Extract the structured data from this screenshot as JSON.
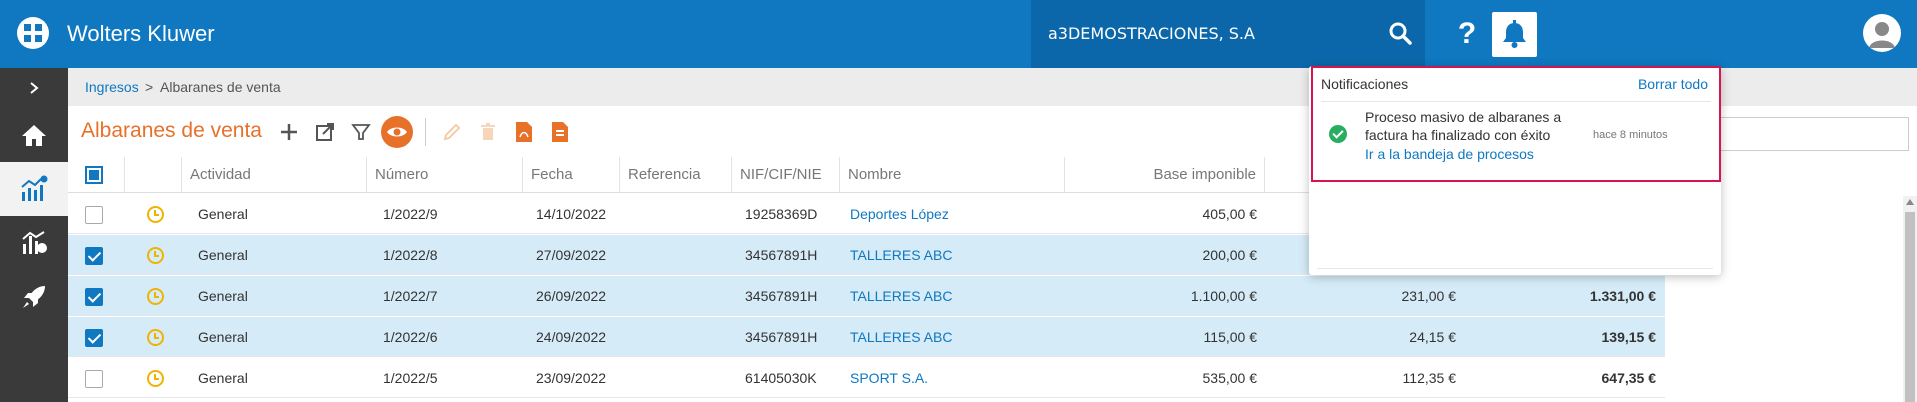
{
  "header": {
    "brand": "Wolters Kluwer",
    "company": "a3DEMOSTRACIONES, S.A",
    "help_label": "?",
    "accent": "#0f78c1"
  },
  "breadcrumb": {
    "parent": "Ingresos",
    "separator": ">",
    "current": "Albaranes de venta"
  },
  "page": {
    "title": "Albaranes de venta",
    "title_color": "#e8712a"
  },
  "table": {
    "columns": [
      "Actividad",
      "Número",
      "Fecha",
      "Referencia",
      "NIF/CIF/NIE",
      "Nombre",
      "Base imponible"
    ],
    "rows": [
      {
        "selected": false,
        "actividad": "General",
        "numero": "1/2022/9",
        "fecha": "14/10/2022",
        "referencia": "",
        "nif": "19258369D",
        "nombre": "Deportes López",
        "base": "405,00 €",
        "cuota": "",
        "total": ""
      },
      {
        "selected": true,
        "actividad": "General",
        "numero": "1/2022/8",
        "fecha": "27/09/2022",
        "referencia": "",
        "nif": "34567891H",
        "nombre": "TALLERES ABC",
        "base": "200,00 €",
        "cuota": "",
        "total": ""
      },
      {
        "selected": true,
        "actividad": "General",
        "numero": "1/2022/7",
        "fecha": "26/09/2022",
        "referencia": "",
        "nif": "34567891H",
        "nombre": "TALLERES ABC",
        "base": "1.100,00 €",
        "cuota": "231,00 €",
        "total": "1.331,00 €"
      },
      {
        "selected": true,
        "actividad": "General",
        "numero": "1/2022/6",
        "fecha": "24/09/2022",
        "referencia": "",
        "nif": "34567891H",
        "nombre": "TALLERES ABC",
        "base": "115,00 €",
        "cuota": "24,15 €",
        "total": "139,15 €"
      },
      {
        "selected": false,
        "actividad": "General",
        "numero": "1/2022/5",
        "fecha": "23/09/2022",
        "referencia": "",
        "nif": "61405030K",
        "nombre": "SPORT S.A.",
        "base": "535,00 €",
        "cuota": "112,35 €",
        "total": "647,35 €"
      }
    ]
  },
  "notifications": {
    "title": "Notificaciones",
    "clear_label": "Borrar todo",
    "items": [
      {
        "message": "Proceso masivo de albaranes a factura ha finalizado con éxito",
        "link": "Ir a la bandeja de procesos",
        "time": "hace 8 minutos",
        "status_color": "#27ae60"
      }
    ],
    "highlight_color": "#d6154f"
  }
}
